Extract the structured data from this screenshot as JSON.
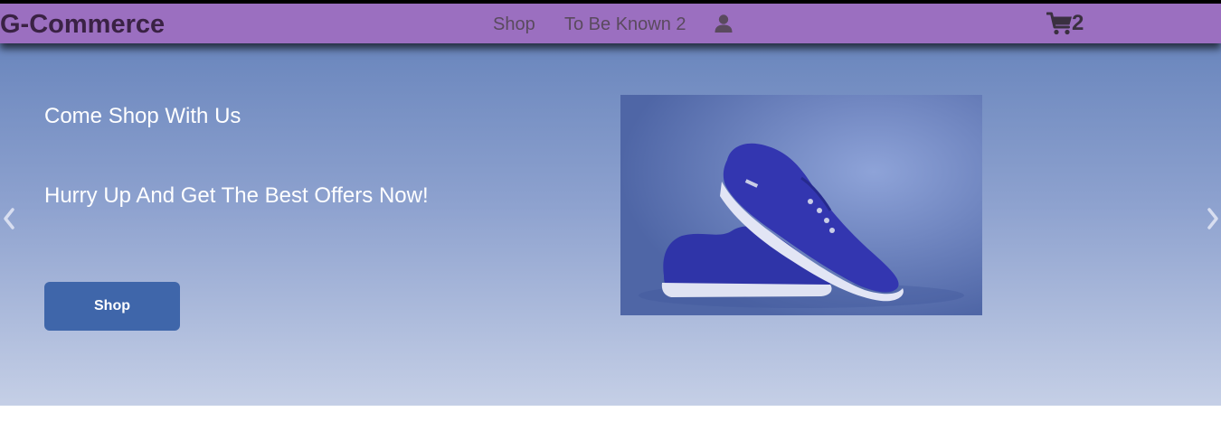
{
  "navbar": {
    "brand": "G-Commerce",
    "links": [
      {
        "label": "Shop"
      },
      {
        "label": "To Be Known 2"
      }
    ],
    "user_icon": "user-icon",
    "cart": {
      "icon": "shopping-cart-icon",
      "count": "2"
    },
    "background_color": "#9b6fc0"
  },
  "hero": {
    "headline_1": "Come Shop With Us",
    "headline_2": "Hurry Up And Get The Best Offers Now!",
    "cta_label": "Shop",
    "cta_color": "#3f66aa",
    "image_subject": "blue canvas sneakers",
    "prev_icon": "chevron-left-icon",
    "next_icon": "chevron-right-icon"
  }
}
